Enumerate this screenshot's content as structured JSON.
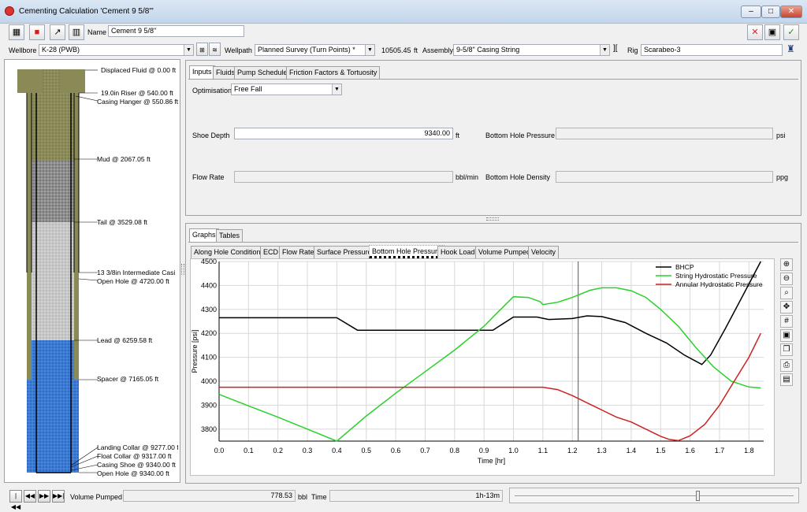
{
  "window": {
    "title": "Cementing Calculation 'Cement 9 5/8\"'"
  },
  "toolbar": {
    "name_label": "Name",
    "name_value": "Cement 9 5/8\""
  },
  "row2": {
    "wellbore_label": "Wellbore",
    "wellbore_value": "K-28 (PWB)",
    "wellpath_label": "Wellpath",
    "wellpath_value": "Planned Survey (Turn Points) *",
    "depth_value": "10505.45",
    "depth_unit": "ft",
    "assembly_label": "Assembly",
    "assembly_value": "9-5/8\" Casing String",
    "rig_label": "Rig",
    "rig_value": "Scarabeo-3"
  },
  "well": {
    "labels": [
      "Displaced Fluid @ 0.00 ft",
      "19.0in Riser @ 540.00 ft",
      "Casing Hanger @ 550.86 ft",
      "Mud @ 2067.05 ft",
      "Tail @ 3529.08 ft",
      "13 3/8in Intermediate Casi",
      "Open Hole @ 4720.00 ft",
      "Lead @ 6259.58 ft",
      "Spacer @ 7165.05 ft",
      "Landing Collar @ 9277.00 ft",
      "Float Collar @ 9317.00 ft",
      "Casing Shoe @ 9340.00 ft",
      "Open Hole @ 9340.00 ft"
    ]
  },
  "top_tabs": [
    "Inputs",
    "Fluids",
    "Pump Schedule",
    "Friction Factors & Tortuosity"
  ],
  "inputs": {
    "optimisation_label": "Optimisation",
    "optimisation_value": "Free Fall",
    "shoe_depth_label": "Shoe Depth",
    "shoe_depth_value": "9340.00",
    "shoe_depth_unit": "ft",
    "bhp_label": "Bottom Hole Pressure",
    "bhp_unit": "psi",
    "flow_rate_label": "Flow Rate",
    "flow_rate_unit": "bbl/min",
    "bhd_label": "Bottom Hole Density",
    "bhd_unit": "ppg"
  },
  "bottom_tabs": [
    "Graphs",
    "Tables"
  ],
  "graph_tabs": [
    "Along Hole Conditions",
    "ECD",
    "Flow Rate",
    "Surface Pressure",
    "Bottom Hole Pressure",
    "Hook Load",
    "Volume Pumped",
    "Velocity"
  ],
  "chart_data": {
    "type": "line",
    "xlabel": "Time [hr]",
    "ylabel": "Pressure [psi]",
    "xlim": [
      0,
      1.85
    ],
    "ylim": [
      3750,
      4500
    ],
    "xticks": [
      0.0,
      0.1,
      0.2,
      0.3,
      0.4,
      0.5,
      0.6,
      0.7,
      0.8,
      0.9,
      1.0,
      1.1,
      1.2,
      1.3,
      1.4,
      1.5,
      1.6,
      1.7,
      1.8
    ],
    "xtick_labels": [
      "0.0",
      "0.1",
      "0.2",
      "0.3",
      "0.4",
      "0.5",
      "0.6",
      "0.7",
      "0.8",
      "0.9",
      "1.0",
      "1.1",
      "1.2",
      "1.3",
      "1.4",
      "1.5",
      "1.6",
      "1.7",
      "1.8"
    ],
    "yticks": [
      3800,
      3900,
      4000,
      4100,
      4200,
      4300,
      4400,
      4500
    ],
    "cursor_x": 1.22,
    "grid": true,
    "legend": "top-right",
    "series": [
      {
        "name": "BHCP",
        "color": "#000000",
        "x": [
          0.0,
          0.4,
          0.47,
          0.93,
          1.0,
          1.08,
          1.12,
          1.2,
          1.25,
          1.3,
          1.38,
          1.45,
          1.52,
          1.58,
          1.64,
          1.67,
          1.72,
          1.78,
          1.84
        ],
        "y": [
          4265,
          4265,
          4213,
          4213,
          4268,
          4268,
          4258,
          4262,
          4273,
          4270,
          4245,
          4200,
          4160,
          4110,
          4070,
          4110,
          4220,
          4360,
          4500
        ]
      },
      {
        "name": "String Hydrostatic Pressure",
        "color": "#2ad12a",
        "x": [
          0.0,
          0.1,
          0.2,
          0.3,
          0.4,
          0.5,
          0.6,
          0.7,
          0.8,
          0.9,
          0.95,
          1.0,
          1.05,
          1.09,
          1.1,
          1.15,
          1.2,
          1.26,
          1.3,
          1.35,
          1.4,
          1.45,
          1.5,
          1.56,
          1.62,
          1.68,
          1.74,
          1.8,
          1.84
        ],
        "y": [
          3945,
          3897,
          3850,
          3800,
          3750,
          3855,
          3950,
          4040,
          4130,
          4230,
          4292,
          4353,
          4350,
          4333,
          4320,
          4330,
          4350,
          4380,
          4390,
          4390,
          4378,
          4350,
          4300,
          4230,
          4140,
          4060,
          4000,
          3976,
          3972
        ]
      },
      {
        "name": "Annular Hydrostatic Pressure",
        "color": "#cc2222",
        "x": [
          0.0,
          1.1,
          1.15,
          1.2,
          1.25,
          1.3,
          1.35,
          1.4,
          1.45,
          1.5,
          1.53,
          1.56,
          1.6,
          1.65,
          1.7,
          1.75,
          1.8,
          1.84
        ],
        "y": [
          3975,
          3975,
          3965,
          3940,
          3910,
          3880,
          3850,
          3830,
          3800,
          3770,
          3757,
          3752,
          3772,
          3820,
          3900,
          4000,
          4100,
          4200
        ]
      }
    ]
  },
  "statusbar": {
    "volume_label": "Volume Pumped",
    "volume_value": "778.53",
    "volume_unit": "bbl",
    "time_label": "Time",
    "time_value": "1h-13m",
    "slider_fraction": 0.65
  }
}
